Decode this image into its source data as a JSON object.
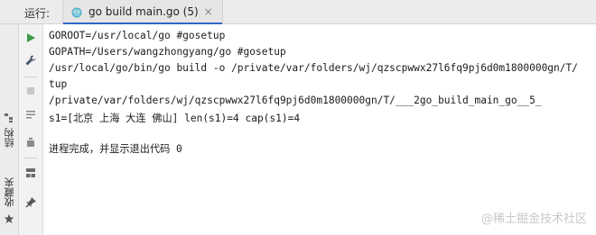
{
  "run_tool_window": {
    "label": "运行:",
    "tab": {
      "title": "go build main.go (5)",
      "close": "×"
    }
  },
  "side_tabs": {
    "structure": "结构",
    "favorites": "收藏夹"
  },
  "toolbar": {
    "icons": [
      "run-icon",
      "wrench-icon",
      "stop-icon",
      "soft-wrap-icon",
      "clear-icon",
      "layout-icon",
      "pin-icon"
    ]
  },
  "console": {
    "lines": [
      "GOROOT=/usr/local/go #gosetup",
      "GOPATH=/Users/wangzhongyang/go #gosetup",
      "/usr/local/go/bin/go build -o /private/var/folders/wj/qzscpwwx27l6fq9pj6d0m1800000gn/T/",
      "tup",
      "/private/var/folders/wj/qzscpwwx27l6fq9pj6d0m1800000gn/T/___2go_build_main_go__5_",
      "s1=[北京 上海 大连 佛山] len(s1)=4 cap(s1)=4",
      "",
      "进程完成，并显示退出代码 0"
    ]
  },
  "watermark": "@稀土掘金技术社区",
  "colors": {
    "accent": "#2f65ca",
    "run": "#3d9a4a",
    "wrench": "#4a5a6a",
    "icon": "#8a8a8a"
  }
}
